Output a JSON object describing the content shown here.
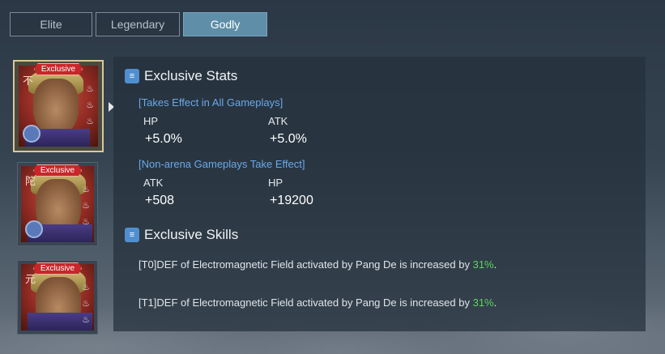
{
  "tabs": [
    {
      "label": "Elite",
      "active": false
    },
    {
      "label": "Legendary",
      "active": false
    },
    {
      "label": "Godly",
      "active": true
    }
  ],
  "portraits": [
    {
      "badge": "Exclusive",
      "glyph": "不",
      "selected": true
    },
    {
      "badge": "Exclusive",
      "glyph": "陀",
      "selected": false
    },
    {
      "badge": "Exclusive",
      "glyph": "元",
      "selected": false
    }
  ],
  "stats": {
    "title": "Exclusive Stats",
    "groups": [
      {
        "scope": "[Takes Effect in All Gameplays]",
        "items": [
          {
            "label": "HP",
            "value": "+5.0%"
          },
          {
            "label": "ATK",
            "value": "+5.0%"
          }
        ]
      },
      {
        "scope": "[Non-arena Gameplays Take Effect]",
        "items": [
          {
            "label": "ATK",
            "value": "+508"
          },
          {
            "label": "HP",
            "value": "+19200"
          }
        ]
      }
    ]
  },
  "skills": {
    "title": "Exclusive Skills",
    "lines": [
      {
        "prefix": "[T0]DEF of Electromagnetic Field activated by Pang De is increased by ",
        "value": "31%",
        "suffix": "."
      },
      {
        "prefix": "[T1]DEF of Electromagnetic Field activated by Pang De is increased by ",
        "value": "31%",
        "suffix": "."
      }
    ]
  },
  "colors": {
    "active_tab": "#5f8ea8",
    "scope_text": "#6aa8e8",
    "highlight": "#5bd65b",
    "badge": "#c8262a"
  }
}
